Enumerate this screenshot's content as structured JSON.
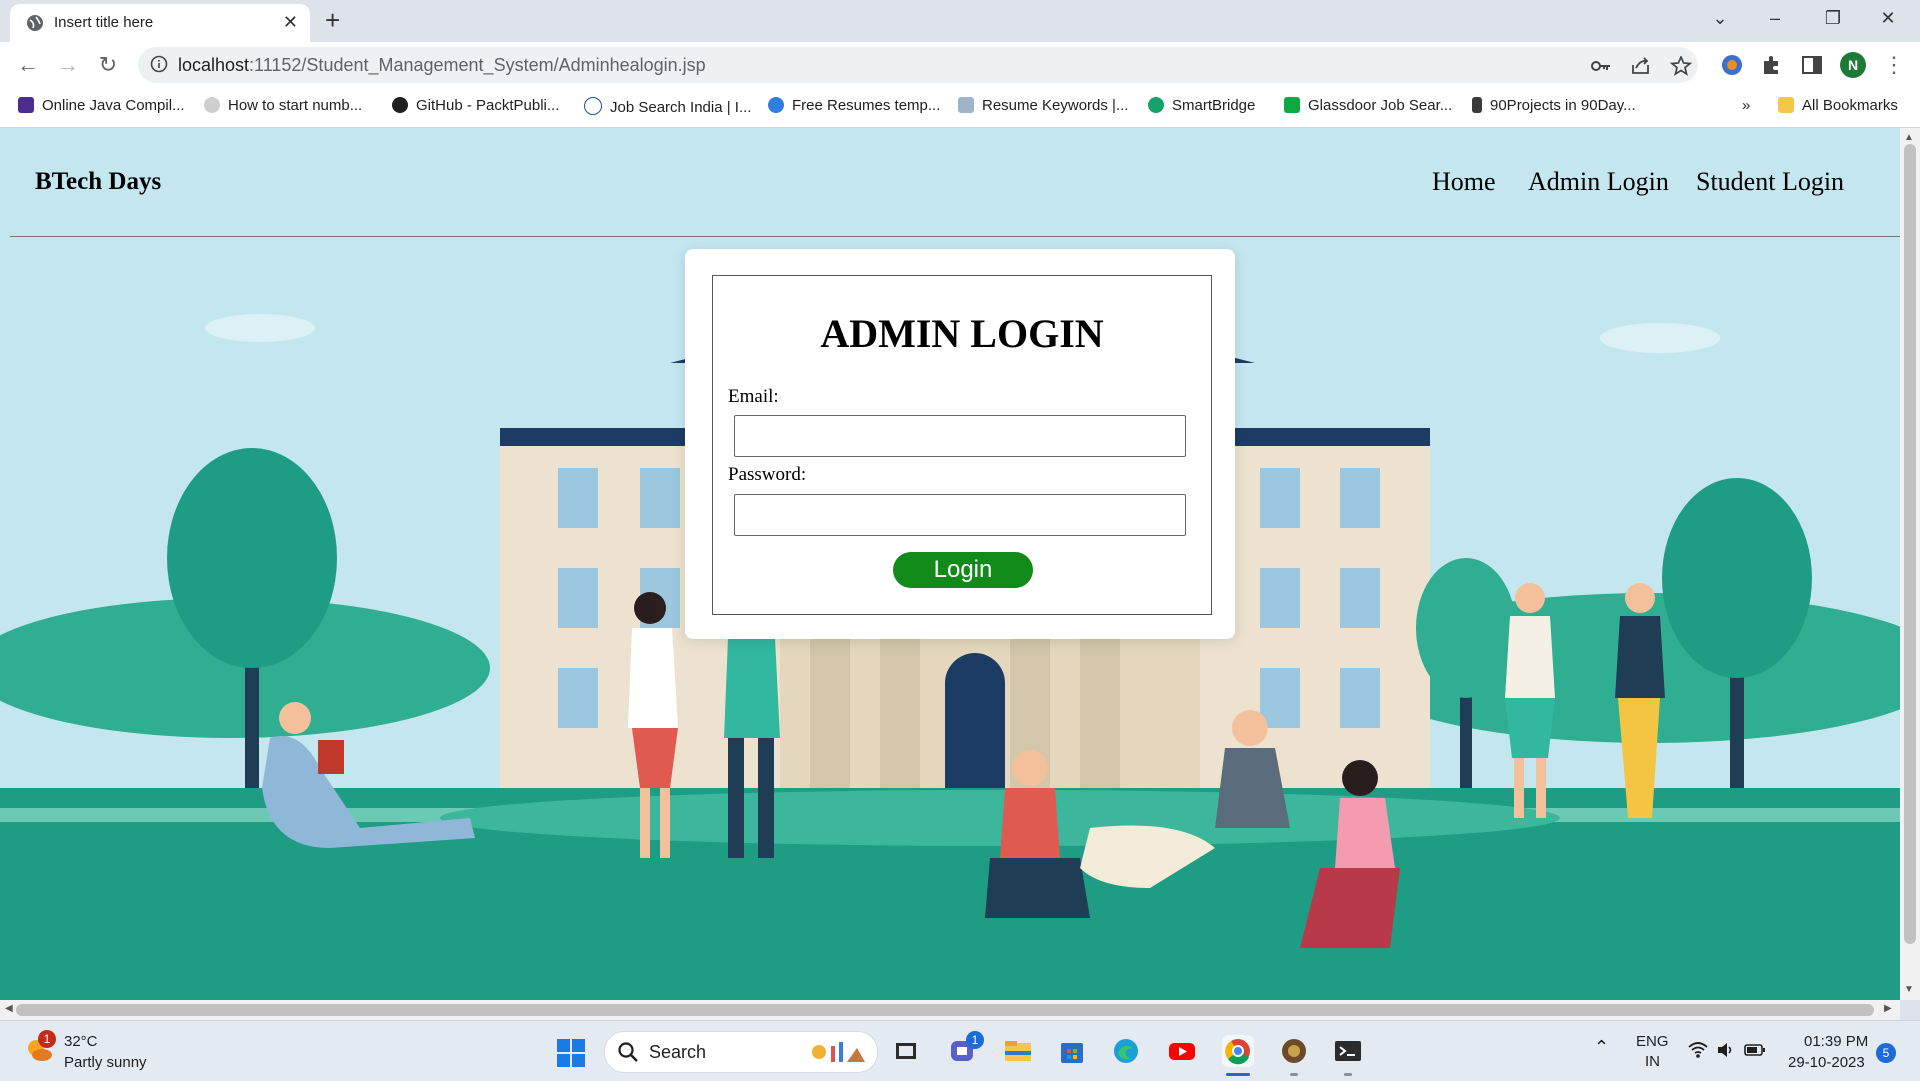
{
  "browser": {
    "tab_title": "Insert title here",
    "new_tab": "+",
    "url_host": "localhost",
    "url_rest": ":11152/Student_Management_System/Adminhealogin.jsp",
    "profile_initial": "N",
    "bookmarks": [
      "Online Java Compil...",
      "How to start numb...",
      "GitHub - PacktPubli...",
      "Job Search India | I...",
      "Free Resumes temp...",
      "Resume Keywords |...",
      "SmartBridge",
      "Glassdoor Job Sear...",
      "90Projects in 90Day..."
    ],
    "bookmarks_overflow": "»",
    "all_bookmarks": "All Bookmarks"
  },
  "page": {
    "brand": "BTech Days",
    "nav": [
      "Home",
      "Admin Login",
      "Student Login"
    ],
    "form": {
      "title": "ADMIN LOGIN",
      "email_label": "Email:",
      "email_value": "",
      "password_label": "Password:",
      "password_value": "",
      "submit_label": "Login"
    }
  },
  "taskbar": {
    "weather_temp": "32°C",
    "weather_desc": "Partly sunny",
    "weather_badge": "1",
    "search_placeholder": "Search",
    "teams_badge": "1",
    "lang_1": "ENG",
    "lang_2": "IN",
    "time": "01:39 PM",
    "date": "29-10-2023",
    "notifications": "5"
  },
  "colors": {
    "login_button": "#118a1a",
    "sky": "#c4e7ef",
    "grass": "#1e9c84"
  }
}
